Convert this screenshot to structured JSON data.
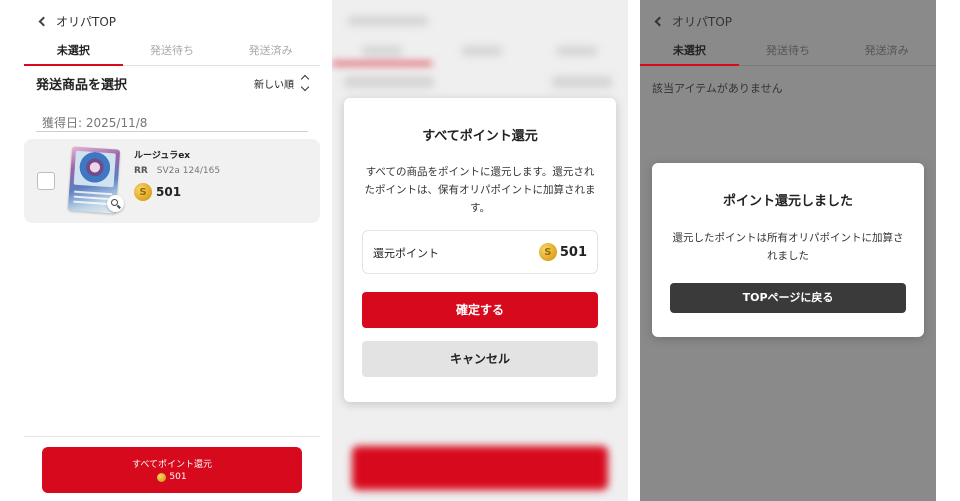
{
  "header": {
    "back_label": "オリパTOP"
  },
  "tabs": [
    "未選択",
    "発送待ち",
    "発送済み"
  ],
  "screen_select": {
    "section_title": "発送商品を選択",
    "sort_label": "新しい順",
    "date_label": "獲得日: 2025/11/8",
    "item": {
      "name": "ルージュラex",
      "rarity": "RR",
      "card_number": "SV2a 124/165",
      "points": "501"
    },
    "bottom_button": {
      "label": "すべてポイント還元",
      "points": "501"
    }
  },
  "screen_confirm": {
    "title": "すべてポイント還元",
    "body": "すべての商品をポイントに還元します。還元されたポイントは、保有オリパポイントに加算されます。",
    "points_label": "還元ポイント",
    "points_value": "501",
    "confirm_label": "確定する",
    "cancel_label": "キャンセル"
  },
  "screen_done": {
    "empty_message": "該当アイテムがありません",
    "modal_title": "ポイント還元しました",
    "modal_body": "還元したポイントは所有オリパポイントに加算されました",
    "top_button_label": "TOPページに戻る"
  },
  "colors": {
    "accent_red": "#d7091c",
    "dark_button": "#3a3a3a",
    "coin_gold": "#dca41d"
  }
}
